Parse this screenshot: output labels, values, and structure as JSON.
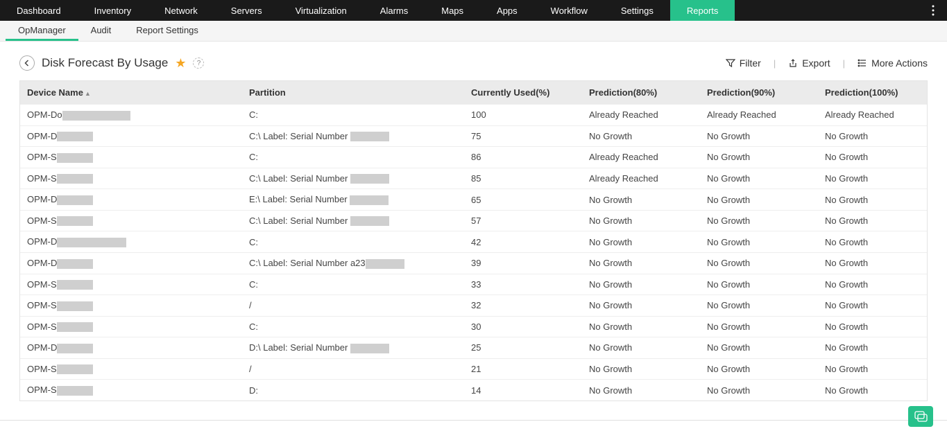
{
  "topnav": {
    "items": [
      {
        "label": "Dashboard"
      },
      {
        "label": "Inventory"
      },
      {
        "label": "Network"
      },
      {
        "label": "Servers"
      },
      {
        "label": "Virtualization"
      },
      {
        "label": "Alarms"
      },
      {
        "label": "Maps"
      },
      {
        "label": "Apps"
      },
      {
        "label": "Workflow"
      },
      {
        "label": "Settings"
      },
      {
        "label": "Reports"
      }
    ]
  },
  "subnav": {
    "items": [
      {
        "label": "OpManager"
      },
      {
        "label": "Audit"
      },
      {
        "label": "Report Settings"
      }
    ]
  },
  "header": {
    "title": "Disk Forecast By Usage",
    "starred": true,
    "help": "?",
    "filter": "Filter",
    "export": "Export",
    "more": "More Actions"
  },
  "table": {
    "columns": {
      "deviceName": "Device Name",
      "partition": "Partition",
      "used": "Currently Used(%)",
      "p80": "Prediction(80%)",
      "p90": "Prediction(90%)",
      "p100": "Prediction(100%)"
    },
    "rows": [
      {
        "device": "OPM-Do",
        "dw": 98,
        "partition": "C:",
        "pPrefix": "",
        "pw": 0,
        "used": "100",
        "p80": "Already Reached",
        "p90": "Already Reached",
        "p100": "Already Reached"
      },
      {
        "device": "OPM-D",
        "dw": 52,
        "partition": "C:\\ Label: Serial Number ",
        "pPrefix": "C:\\ Label: Serial Number ",
        "pw": 56,
        "used": "75",
        "p80": "No Growth",
        "p90": "No Growth",
        "p100": "No Growth"
      },
      {
        "device": "OPM-S",
        "dw": 52,
        "partition": "C:",
        "pPrefix": "",
        "pw": 0,
        "used": "86",
        "p80": "Already Reached",
        "p90": "No Growth",
        "p100": "No Growth"
      },
      {
        "device": "OPM-S",
        "dw": 52,
        "partition": "C:\\ Label: Serial Number ",
        "pPrefix": "C:\\ Label: Serial Number ",
        "pw": 56,
        "used": "85",
        "p80": "Already Reached",
        "p90": "No Growth",
        "p100": "No Growth"
      },
      {
        "device": "OPM-D",
        "dw": 52,
        "partition": "E:\\ Label: Serial Number ",
        "pPrefix": "E:\\ Label: Serial Number ",
        "pw": 56,
        "used": "65",
        "p80": "No Growth",
        "p90": "No Growth",
        "p100": "No Growth"
      },
      {
        "device": "OPM-S",
        "dw": 52,
        "partition": "C:\\ Label: Serial Number ",
        "pPrefix": "C:\\ Label: Serial Number ",
        "pw": 56,
        "used": "57",
        "p80": "No Growth",
        "p90": "No Growth",
        "p100": "No Growth"
      },
      {
        "device": "OPM-D",
        "dw": 100,
        "partition": "C:",
        "pPrefix": "",
        "pw": 0,
        "used": "42",
        "p80": "No Growth",
        "p90": "No Growth",
        "p100": "No Growth"
      },
      {
        "device": "OPM-D",
        "dw": 52,
        "partition": "C:\\ Label: Serial Number a23",
        "pPrefix": "C:\\ Label: Serial Number a23",
        "pw": 56,
        "used": "39",
        "p80": "No Growth",
        "p90": "No Growth",
        "p100": "No Growth"
      },
      {
        "device": "OPM-S",
        "dw": 52,
        "partition": "C:",
        "pPrefix": "",
        "pw": 0,
        "used": "33",
        "p80": "No Growth",
        "p90": "No Growth",
        "p100": "No Growth"
      },
      {
        "device": "OPM-S",
        "dw": 52,
        "partition": "/",
        "pPrefix": "",
        "pw": 0,
        "used": "32",
        "p80": "No Growth",
        "p90": "No Growth",
        "p100": "No Growth"
      },
      {
        "device": "OPM-S",
        "dw": 52,
        "partition": "C:",
        "pPrefix": "",
        "pw": 0,
        "used": "30",
        "p80": "No Growth",
        "p90": "No Growth",
        "p100": "No Growth"
      },
      {
        "device": "OPM-D",
        "dw": 52,
        "partition": "D:\\ Label: Serial Number ",
        "pPrefix": "D:\\ Label: Serial Number ",
        "pw": 56,
        "used": "25",
        "p80": "No Growth",
        "p90": "No Growth",
        "p100": "No Growth"
      },
      {
        "device": "OPM-S",
        "dw": 52,
        "partition": "/",
        "pPrefix": "",
        "pw": 0,
        "used": "21",
        "p80": "No Growth",
        "p90": "No Growth",
        "p100": "No Growth"
      },
      {
        "device": "OPM-S",
        "dw": 52,
        "partition": "D:",
        "pPrefix": "",
        "pw": 0,
        "used": "14",
        "p80": "No Growth",
        "p90": "No Growth",
        "p100": "No Growth"
      }
    ]
  }
}
